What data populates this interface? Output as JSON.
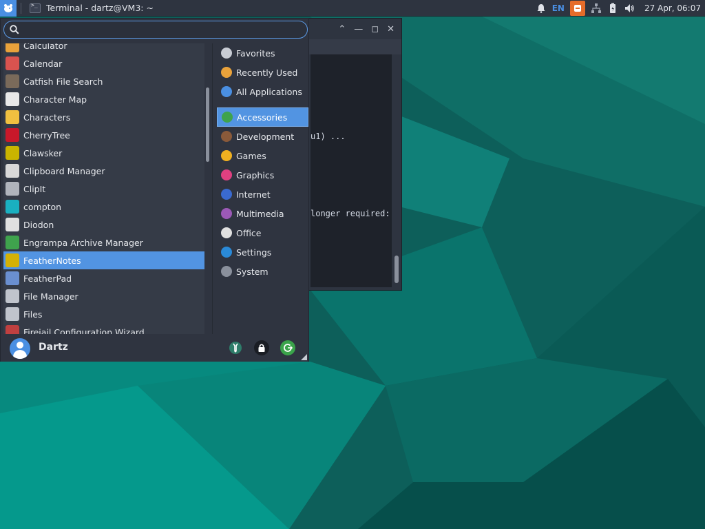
{
  "panel": {
    "window_title": "Terminal - dartz@VM3: ~",
    "language": "EN",
    "clock": "27 Apr, 06:07"
  },
  "terminal": {
    "lines": [
      {
        "text": "u1) ..."
      },
      {
        "text": "longer required:"
      }
    ]
  },
  "search": {
    "placeholder": "",
    "value": ""
  },
  "apps": [
    {
      "label": "Calculator",
      "icon": "calculator-icon",
      "color": "#e9a23b"
    },
    {
      "label": "Calendar",
      "icon": "calendar-icon",
      "color": "#d9534f"
    },
    {
      "label": "Catfish File Search",
      "icon": "catfish-icon",
      "color": "#7a6a5a"
    },
    {
      "label": "Character Map",
      "icon": "character-map-icon",
      "color": "#e8e8e8"
    },
    {
      "label": "Characters",
      "icon": "characters-icon",
      "color": "#f0c040"
    },
    {
      "label": "CherryTree",
      "icon": "cherrytree-icon",
      "color": "#c8182a"
    },
    {
      "label": "Clawsker",
      "icon": "clawsker-icon",
      "color": "#c9b400"
    },
    {
      "label": "Clipboard Manager",
      "icon": "clipboard-icon",
      "color": "#d8d8d8"
    },
    {
      "label": "ClipIt",
      "icon": "clipit-icon",
      "color": "#b0b4bc"
    },
    {
      "label": "compton",
      "icon": "compton-icon",
      "color": "#1ab0c0"
    },
    {
      "label": "Diodon",
      "icon": "diodon-icon",
      "color": "#e0e0e0"
    },
    {
      "label": "Engrampa Archive Manager",
      "icon": "archive-icon",
      "color": "#3fa34d"
    },
    {
      "label": "FeatherNotes",
      "icon": "feathernotes-icon",
      "color": "#d4b106"
    },
    {
      "label": "FeatherPad",
      "icon": "featherpad-icon",
      "color": "#6a8fd0"
    },
    {
      "label": "File Manager",
      "icon": "file-manager-icon",
      "color": "#c0c4cc"
    },
    {
      "label": "Files",
      "icon": "files-icon",
      "color": "#c0c4cc"
    },
    {
      "label": "Firejail Configuration Wizard",
      "icon": "firejail-icon",
      "color": "#c04040"
    }
  ],
  "selected_app_index": 12,
  "categories": [
    {
      "label": "Favorites",
      "icon": "star-icon",
      "color": "#c8ccd4"
    },
    {
      "label": "Recently Used",
      "icon": "clock-icon",
      "color": "#e9a23b"
    },
    {
      "label": "All Applications",
      "icon": "dots-icon",
      "color": "#4a8fe2"
    },
    {
      "label": "Accessories",
      "icon": "accessories-icon",
      "color": "#3fa34d"
    },
    {
      "label": "Development",
      "icon": "development-icon",
      "color": "#8a5a3a"
    },
    {
      "label": "Games",
      "icon": "gamepad-icon",
      "color": "#f0b020"
    },
    {
      "label": "Graphics",
      "icon": "graphics-icon",
      "color": "#e04080"
    },
    {
      "label": "Internet",
      "icon": "globe-icon",
      "color": "#3a6ad0"
    },
    {
      "label": "Multimedia",
      "icon": "multimedia-icon",
      "color": "#9b59b6"
    },
    {
      "label": "Office",
      "icon": "office-icon",
      "color": "#e0e0e0"
    },
    {
      "label": "Settings",
      "icon": "settings-icon",
      "color": "#2a8ad8"
    },
    {
      "label": "System",
      "icon": "system-gear-icon",
      "color": "#8a909c"
    }
  ],
  "active_category_index": 3,
  "user": {
    "name": "Dartz"
  }
}
